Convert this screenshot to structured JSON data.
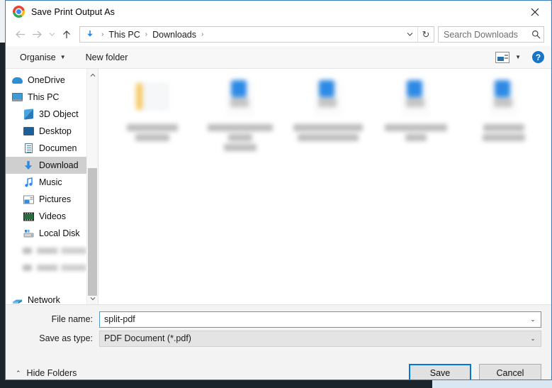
{
  "window": {
    "title": "Save Print Output As",
    "app_icon": "chrome-logo-icon",
    "close_label": "✕"
  },
  "navbar": {
    "back_icon": "back-arrow-icon",
    "forward_icon": "forward-arrow-icon",
    "recent_icon": "recent-locations-chevron-icon",
    "up_icon": "up-arrow-icon",
    "crumb_icon": "downloads-arrow-icon",
    "breadcrumbs": [
      "This PC",
      "Downloads"
    ],
    "separator": "›",
    "dropdown_icon": "chevron-down-icon",
    "refresh_icon": "refresh-icon",
    "refresh_glyph": "↻"
  },
  "search": {
    "placeholder": "Search Downloads",
    "icon": "search-icon"
  },
  "toolbar": {
    "organise_label": "Organise",
    "organise_caret": "▼",
    "new_folder_label": "New folder",
    "view_icon": "view-mode-icon",
    "view_caret": "▼",
    "help_icon": "help-icon",
    "help_glyph": "?"
  },
  "sidebar": {
    "items": [
      {
        "label": "OneDrive",
        "icon": "onedrive-icon",
        "indent": false,
        "selected": false,
        "redacted": false
      },
      {
        "label": "This PC",
        "icon": "this-pc-icon",
        "indent": false,
        "selected": false,
        "redacted": false
      },
      {
        "label": "3D Object",
        "icon": "3d-objects-icon",
        "indent": true,
        "selected": false,
        "redacted": false
      },
      {
        "label": "Desktop",
        "icon": "desktop-icon",
        "indent": true,
        "selected": false,
        "redacted": false
      },
      {
        "label": "Documen",
        "icon": "documents-icon",
        "indent": true,
        "selected": false,
        "redacted": false
      },
      {
        "label": "Download",
        "icon": "downloads-icon",
        "indent": true,
        "selected": true,
        "redacted": false
      },
      {
        "label": "Music",
        "icon": "music-icon",
        "indent": true,
        "selected": false,
        "redacted": false
      },
      {
        "label": "Pictures",
        "icon": "pictures-icon",
        "indent": true,
        "selected": false,
        "redacted": false
      },
      {
        "label": "Videos",
        "icon": "videos-icon",
        "indent": true,
        "selected": false,
        "redacted": false
      },
      {
        "label": "Local Disk",
        "icon": "local-disk-icon",
        "indent": true,
        "selected": false,
        "redacted": false
      },
      {
        "label": "",
        "icon": "drive-icon",
        "indent": true,
        "selected": false,
        "redacted": true
      },
      {
        "label": "",
        "icon": "drive-icon",
        "indent": true,
        "selected": false,
        "redacted": true
      },
      {
        "label": "Network",
        "icon": "network-icon",
        "indent": false,
        "selected": false,
        "redacted": false
      }
    ],
    "network_caret": "⌄",
    "scroll_up_glyph": "⌃",
    "scroll_down_glyph": "⌄"
  },
  "files": {
    "items": [
      {
        "type": "folder",
        "icon": "folder-icon",
        "name": "",
        "redacted": true
      },
      {
        "type": "file",
        "icon": "file-icon",
        "name": "",
        "redacted": true
      },
      {
        "type": "file",
        "icon": "file-icon",
        "name": "",
        "redacted": true
      },
      {
        "type": "file",
        "icon": "file-icon",
        "name": "",
        "redacted": true
      },
      {
        "type": "file",
        "icon": "file-icon",
        "name": "",
        "redacted": true
      }
    ]
  },
  "form": {
    "file_name_label": "File name:",
    "file_name_value": "split-pdf",
    "save_as_type_label": "Save as type:",
    "save_as_type_value": "PDF Document (*.pdf)",
    "caret": "⌄"
  },
  "footer": {
    "hide_folders_label": "Hide Folders",
    "hide_folders_caret": "⌃",
    "save_label": "Save",
    "cancel_label": "Cancel"
  },
  "colors": {
    "accent": "#0078d7",
    "focus_border": "#4aa0c8",
    "window_border": "#3a7cb8",
    "selection": "#cfcfcf"
  }
}
